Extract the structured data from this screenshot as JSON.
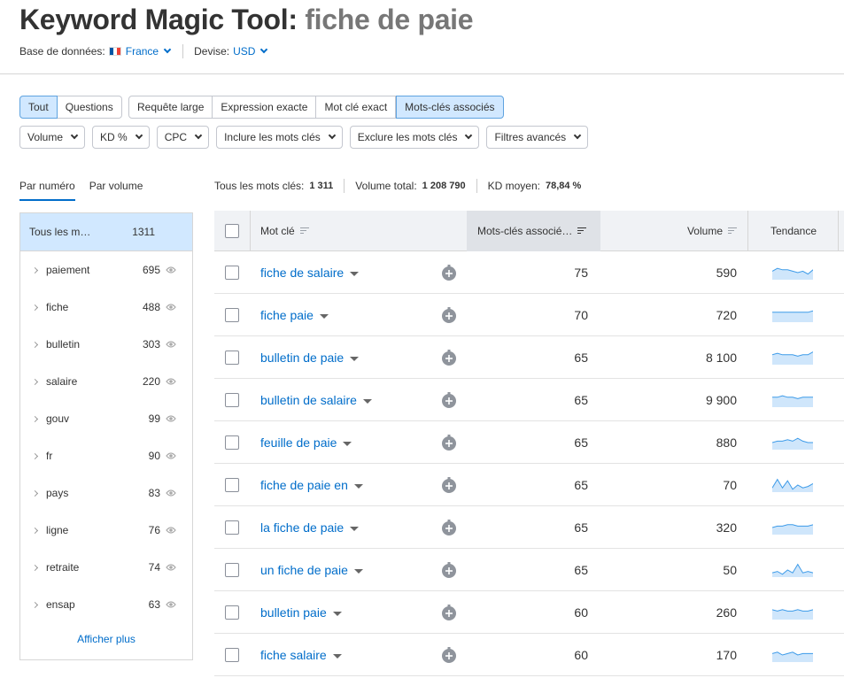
{
  "header": {
    "title_prefix": "Keyword Magic Tool:",
    "query": "fiche de paie",
    "database_label": "Base de données:",
    "database_value": "France",
    "currency_label": "Devise:",
    "currency_value": "USD"
  },
  "match_tabs": [
    {
      "label": "Tout",
      "active": true
    },
    {
      "label": "Questions",
      "active": false
    }
  ],
  "match_types": [
    {
      "label": "Requête large",
      "active": false
    },
    {
      "label": "Expression exacte",
      "active": false
    },
    {
      "label": "Mot clé exact",
      "active": false
    },
    {
      "label": "Mots-clés associés",
      "active": true
    }
  ],
  "filters": [
    "Volume",
    "KD %",
    "CPC",
    "Inclure les mots clés",
    "Exclure les mots clés",
    "Filtres avancés"
  ],
  "sort_tabs": {
    "by_number": "Par numéro",
    "by_volume": "Par volume"
  },
  "stats": {
    "all_keywords_label": "Tous les mots clés:",
    "all_keywords_value": "1 311",
    "total_volume_label": "Volume total:",
    "total_volume_value": "1 208 790",
    "avg_kd_label": "KD moyen:",
    "avg_kd_value": "78,84 %"
  },
  "sidebar": {
    "all_label": "Tous les m…",
    "all_count": "1311",
    "items": [
      {
        "label": "paiement",
        "count": "695"
      },
      {
        "label": "fiche",
        "count": "488"
      },
      {
        "label": "bulletin",
        "count": "303"
      },
      {
        "label": "salaire",
        "count": "220"
      },
      {
        "label": "gouv",
        "count": "99"
      },
      {
        "label": "fr",
        "count": "90"
      },
      {
        "label": "pays",
        "count": "83"
      },
      {
        "label": "ligne",
        "count": "76"
      },
      {
        "label": "retraite",
        "count": "74"
      },
      {
        "label": "ensap",
        "count": "63"
      }
    ],
    "show_more": "Afficher plus"
  },
  "table": {
    "col_keyword": "Mot clé",
    "col_related": "Mots-clés associé…",
    "col_volume": "Volume",
    "col_trend": "Tendance",
    "rows": [
      {
        "keyword": "fiche de salaire",
        "related": "75",
        "volume": "590",
        "trend": [
          6,
          8,
          7,
          7,
          6,
          5,
          6,
          4,
          7
        ]
      },
      {
        "keyword": "fiche paie",
        "related": "70",
        "volume": "720",
        "trend": [
          7,
          7,
          7,
          7,
          7,
          7,
          7,
          7,
          8
        ]
      },
      {
        "keyword": "bulletin de paie",
        "related": "65",
        "volume": "8 100",
        "trend": [
          7,
          8,
          7,
          7,
          7,
          6,
          7,
          7,
          9
        ]
      },
      {
        "keyword": "bulletin de salaire",
        "related": "65",
        "volume": "9 900",
        "trend": [
          7,
          7,
          8,
          7,
          7,
          6,
          7,
          7,
          7
        ]
      },
      {
        "keyword": "feuille de paie",
        "related": "65",
        "volume": "880",
        "trend": [
          5,
          6,
          6,
          7,
          6,
          8,
          6,
          5,
          5
        ]
      },
      {
        "keyword": "fiche de paie en",
        "related": "65",
        "volume": "70",
        "trend": [
          3,
          9,
          3,
          8,
          2,
          5,
          3,
          4,
          6
        ]
      },
      {
        "keyword": "la fiche de paie",
        "related": "65",
        "volume": "320",
        "trend": [
          5,
          6,
          6,
          7,
          7,
          6,
          6,
          6,
          7
        ]
      },
      {
        "keyword": "un fiche de paie",
        "related": "65",
        "volume": "50",
        "trend": [
          3,
          4,
          2,
          5,
          3,
          9,
          3,
          4,
          3
        ]
      },
      {
        "keyword": "bulletin paie",
        "related": "60",
        "volume": "260",
        "trend": [
          7,
          6,
          7,
          6,
          6,
          7,
          6,
          6,
          7
        ]
      },
      {
        "keyword": "fiche salaire",
        "related": "60",
        "volume": "170",
        "trend": [
          6,
          7,
          5,
          6,
          7,
          5,
          6,
          6,
          6
        ]
      }
    ]
  },
  "colors": {
    "accent": "#006dca",
    "active_bg": "#d1e8ff",
    "trend_fill": "#cfe6fb",
    "trend_line": "#3d9be9"
  }
}
